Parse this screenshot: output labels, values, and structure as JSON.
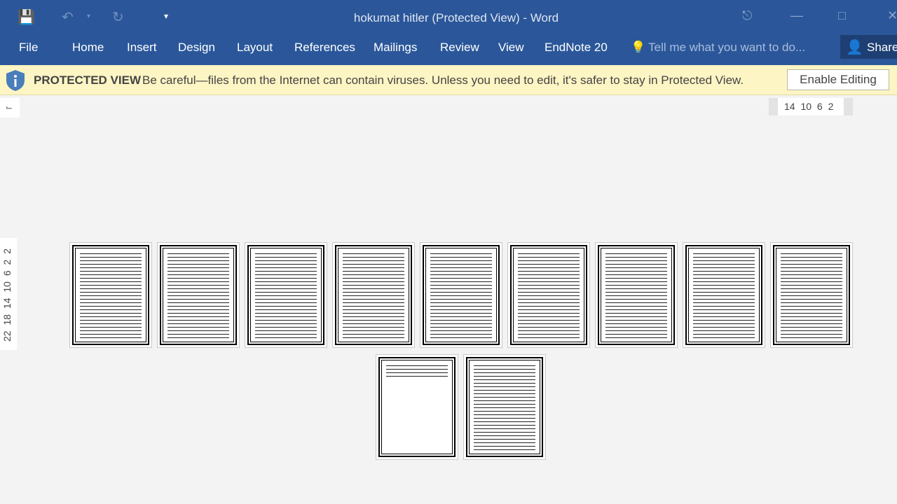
{
  "window": {
    "title": "hokumat hitler (Protected View) - Word"
  },
  "quick_access": {
    "save_icon": "save-icon",
    "undo_icon": "undo-icon",
    "redo_icon": "redo-icon",
    "customize_icon": "customize-icon"
  },
  "ribbon": {
    "tabs": [
      "File",
      "Home",
      "Insert",
      "Design",
      "Layout",
      "References",
      "Mailings",
      "Review",
      "View",
      "EndNote 20"
    ],
    "tell_me": "Tell me what you want to do...",
    "share": "Share"
  },
  "protected_view": {
    "label": "PROTECTED VIEW",
    "message": "Be careful—files from the Internet can contain viruses. Unless you need to edit, it's safer to stay in Protected View.",
    "button": "Enable Editing"
  },
  "rulers": {
    "horizontal": "14 10 6 2",
    "vertical": "22 18 14 10 6 2 2"
  },
  "document": {
    "page_count": 11
  },
  "colors": {
    "ribbon": "#2b579a",
    "protected_bar": "#fdf5c4"
  }
}
